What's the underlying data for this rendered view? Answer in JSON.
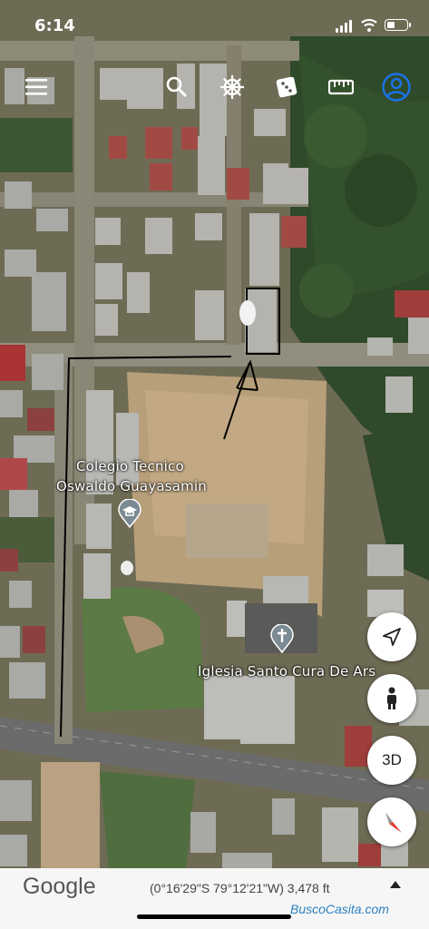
{
  "status_bar": {
    "time": "6:14"
  },
  "toolbar": {
    "menu_icon": "hamburger-menu-icon",
    "search_icon": "search-icon",
    "voyager_icon": "ship-wheel-icon",
    "feeling_lucky_icon": "dice-icon",
    "measure_icon": "ruler-icon",
    "account_icon": "account-icon"
  },
  "places": [
    {
      "name": "Colegio Tecnico\nOswaldo Guayasamin",
      "line1": "Colegio Tecnico",
      "line2": "Oswaldo Guayasamin",
      "icon": "school-cap-pin-icon"
    },
    {
      "name": "Iglesia Santo Cura De Ars",
      "icon": "church-cross-pin-icon"
    }
  ],
  "controls": {
    "compass_nav_icon": "navigation-arrow-icon",
    "pegman_icon": "pegman-icon",
    "view_3d_label": "3D",
    "compass_icon": "compass-icon"
  },
  "bottom_bar": {
    "logo": "Google",
    "coordinates": "(0°16'29\"S 79°12'21\"W) 3,478 ft",
    "expand_icon": "caret-up-icon",
    "watermark": "BuscoCasita.com"
  },
  "colors": {
    "accent_blue": "#1a73e8",
    "compass_red": "#e53935",
    "vegetation": "#2f4a2a"
  }
}
